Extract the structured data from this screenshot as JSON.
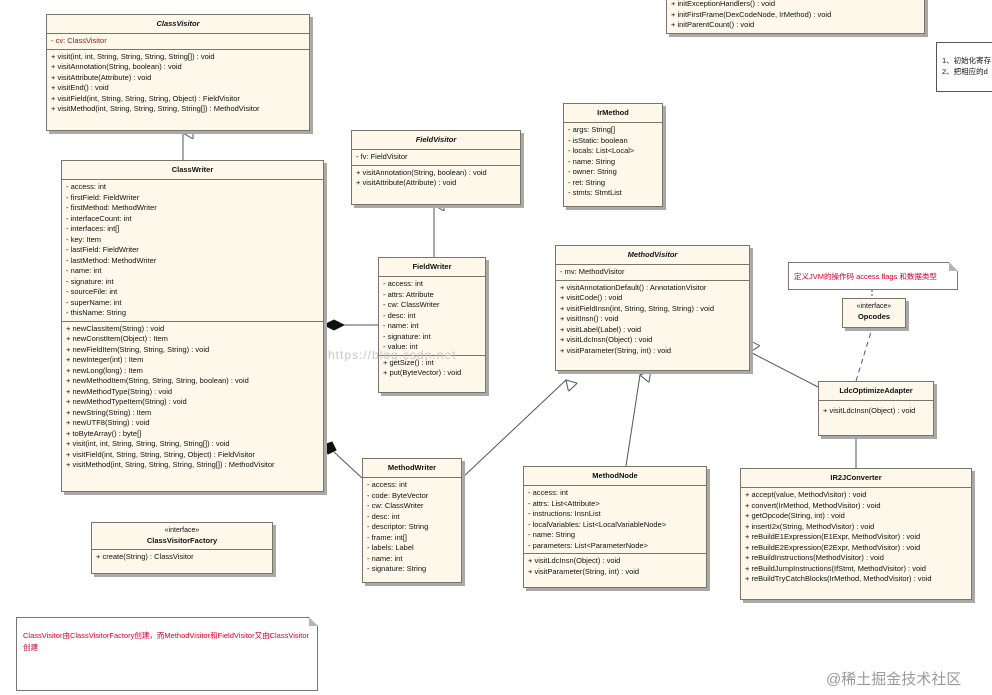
{
  "classes": {
    "class_visitor": {
      "name": "ClassVisitor",
      "attributes": [
        "-   cv:  ClassVisitor"
      ],
      "methods": [
        "+   visit(int, int, String, String, String, String[]) : void",
        "+   visitAnnotation(String, boolean) : void",
        "+   visitAttribute(Attribute) : void",
        "+   visitEnd() : void",
        "+   visitField(int, String, String, String, Object) : FieldVisitor",
        "+   visitMethod(int, String, String, String, String[]) : MethodVisitor"
      ]
    },
    "class_writer": {
      "name": "ClassWriter",
      "attributes": [
        "-   access:  int",
        "-   firstField:  FieldWriter",
        "-   firstMethod:  MethodWriter",
        "-   interfaceCount:  int",
        "-   interfaces:  int[]",
        "-   key:  Item",
        "-   lastField:  FieldWriter",
        "-   lastMethod:  MethodWriter",
        "-   name:  int",
        "-   signature:  int",
        "-   sourceFile:  int",
        "-   superName:  int",
        "-   thisName:  String"
      ],
      "methods": [
        "+   newClassItem(String) : void",
        "+   newConstItem(Object) : Item",
        "+   newFieldItem(String, String, String) : void",
        "+   newInteger(int) : Item",
        "+   newLong(long) : Item",
        "+   newMethodItem(String, String, String, boolean) : void",
        "+   newMethodType(String) : void",
        "+   newMethodTypeItem(String) : void",
        "+   newString(String) : Item",
        "+   newUTF8(String) : void",
        "+   toByteArray() : byte[]",
        "+   visit(int, int, String, String, String, String[]) : void",
        "+   visitField(int, String, String, String, Object) : FieldVisitor",
        "+   visitMethod(int, String, String, String, String[]) : MethodVisitor"
      ]
    },
    "class_visitor_factory": {
      "stereotype": "«interface»",
      "name": "ClassVisitorFactory",
      "methods": [
        "+   create(String) : ClassVisitor"
      ]
    },
    "field_visitor": {
      "name": "FieldVisitor",
      "attributes": [
        "-   fv:  FieldVisitor"
      ],
      "methods": [
        "+   visitAnnotation(String, boolean) : void",
        "+   visitAttribute(Attribute) : void"
      ]
    },
    "field_writer": {
      "name": "FieldWriter",
      "attributes": [
        "-   access:  int",
        "-   attrs:  Attribute",
        "-   cw:  ClassWriter",
        "-   desc:  int",
        "-   name:  int",
        "-   signature:  int",
        "-   value:  int"
      ],
      "methods": [
        "+   getSize() : int",
        "+   put(ByteVector) : void"
      ]
    },
    "ir_method": {
      "name": "IrMethod",
      "attributes": [
        "-   args:  String[]",
        "-   isStatic:  boolean",
        "-   locals:  List<Local>",
        "-   name:  String",
        "-   owner:  String",
        "-   ret:  String",
        "-   stmts:  StmtList"
      ]
    },
    "method_visitor": {
      "name": "MethodVisitor",
      "attributes": [
        "-   mv:  MethodVisitor"
      ],
      "methods": [
        "+   visitAnnotationDefault() : AnnotationVisitor",
        "+   visitCode() : void",
        "+   visitFieldInsn(int, String, String, String) : void",
        "+   visitInsn() : void",
        "+   visitLabel(Label) : void",
        "+   visitLdcInsn(Object) : void",
        "+   visitParameter(String, int) : void"
      ]
    },
    "method_writer": {
      "name": "MethodWriter",
      "attributes": [
        "-   access:  int",
        "-   code:  ByteVector",
        "-   cw:  ClassWriter",
        "-   desc:  int",
        "-   descriptor:  String",
        "-   frame:  int[]",
        "-   labels:  Label",
        "-   name:  int",
        "-   signature:  String"
      ]
    },
    "method_node": {
      "name": "MethodNode",
      "attributes": [
        "-   access:  int",
        "-   attrs:  List<Attribute>",
        "-   instructions:  InsnList",
        "-   localVariables:  List<LocalVariableNode>",
        "-   name:  String",
        "-   parameters:  List<ParameterNode>"
      ],
      "methods": [
        "+   visitLdcInsn(Object) : void",
        "+   visitParameter(String, int) : void"
      ]
    },
    "opcodes": {
      "stereotype": "«interface»",
      "name": "Opcodes"
    },
    "ldc_optimize_adapter": {
      "name": "LdcOptimizeAdapter",
      "methods": [
        "+   visitLdcInsn(Object) : void"
      ]
    },
    "ir2j_converter": {
      "name": "IR2JConverter",
      "methods": [
        "+   accept(value, MethodVisitor) : void",
        "+   convert(IrMethod, MethodVisitor) : void",
        "+   getOpcode(String, int) : void",
        "+   insertI2x(String, MethodVisitor) : void",
        "+   reBuildE1Expression(E1Expr, MethodVisitor) : void",
        "+   reBuildE2Expression(E2Expr, MethodVisitor) : void",
        "+   reBuildInstructions(MethodVisitor) : void",
        "+   reBuildJumpInstructions(IfStmt, MethodVisitor) : void",
        "+   reBuildTryCatchBlocks(IrMethod, MethodVisitor) : void"
      ]
    },
    "top_partial": {
      "methods": [
        "+   initExceptionHandlers() : void",
        "+   initFirstFrame(DexCodeNode, IrMethod) : void",
        "+   initParentCount() : void"
      ]
    }
  },
  "notes": {
    "opcodes_note": "定义JVM的操作码 access flags 和数据类型",
    "bottom_note": "ClassVisitor由ClassVisitorFactory创建，而MethodVisitor和FieldVisitor又由ClassVisitor创建",
    "right_note_line1": "1、初始化寄存",
    "right_note_line2": "2、把相应的d"
  },
  "watermark_url": "https://blog.csdn.net",
  "watermark_site": "@稀土掘金技术社区",
  "colors": {
    "box_fill": "#fdf8ea",
    "box_border": "#7a7566",
    "note_red": "#d8002a"
  }
}
